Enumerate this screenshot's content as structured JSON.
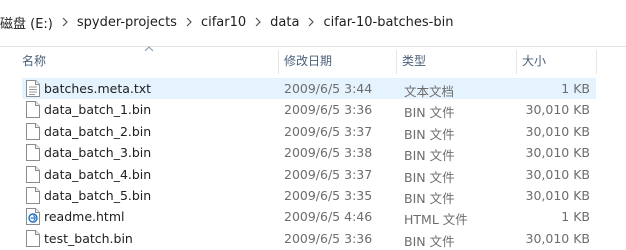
{
  "breadcrumb": {
    "drive": "磁盘 (E:)",
    "items": [
      "spyder-projects",
      "cifar10",
      "data",
      "cifar-10-batches-bin"
    ]
  },
  "columns": {
    "name": "名称",
    "date": "修改日期",
    "type": "类型",
    "size": "大小"
  },
  "files": [
    {
      "name": "batches.meta.txt",
      "date": "2009/6/5 3:44",
      "type": "文本文档",
      "size": "1 KB",
      "icon": "text-file-icon",
      "selected": true
    },
    {
      "name": "data_batch_1.bin",
      "date": "2009/6/5 3:36",
      "type": "BIN 文件",
      "size": "30,010 KB",
      "icon": "file-icon",
      "selected": false
    },
    {
      "name": "data_batch_2.bin",
      "date": "2009/6/5 3:37",
      "type": "BIN 文件",
      "size": "30,010 KB",
      "icon": "file-icon",
      "selected": false
    },
    {
      "name": "data_batch_3.bin",
      "date": "2009/6/5 3:38",
      "type": "BIN 文件",
      "size": "30,010 KB",
      "icon": "file-icon",
      "selected": false
    },
    {
      "name": "data_batch_4.bin",
      "date": "2009/6/5 3:37",
      "type": "BIN 文件",
      "size": "30,010 KB",
      "icon": "file-icon",
      "selected": false
    },
    {
      "name": "data_batch_5.bin",
      "date": "2009/6/5 3:35",
      "type": "BIN 文件",
      "size": "30,010 KB",
      "icon": "file-icon",
      "selected": false
    },
    {
      "name": "readme.html",
      "date": "2009/6/5 4:46",
      "type": "HTML 文件",
      "size": "1 KB",
      "icon": "html-file-icon",
      "selected": false
    },
    {
      "name": "test_batch.bin",
      "date": "2009/6/5 3:36",
      "type": "BIN 文件",
      "size": "30,010 KB",
      "icon": "file-icon",
      "selected": false
    }
  ],
  "colors": {
    "selected_row": "#e5f3ff",
    "header_text": "#4c607a",
    "secondary_text": "#6d6d6d"
  }
}
